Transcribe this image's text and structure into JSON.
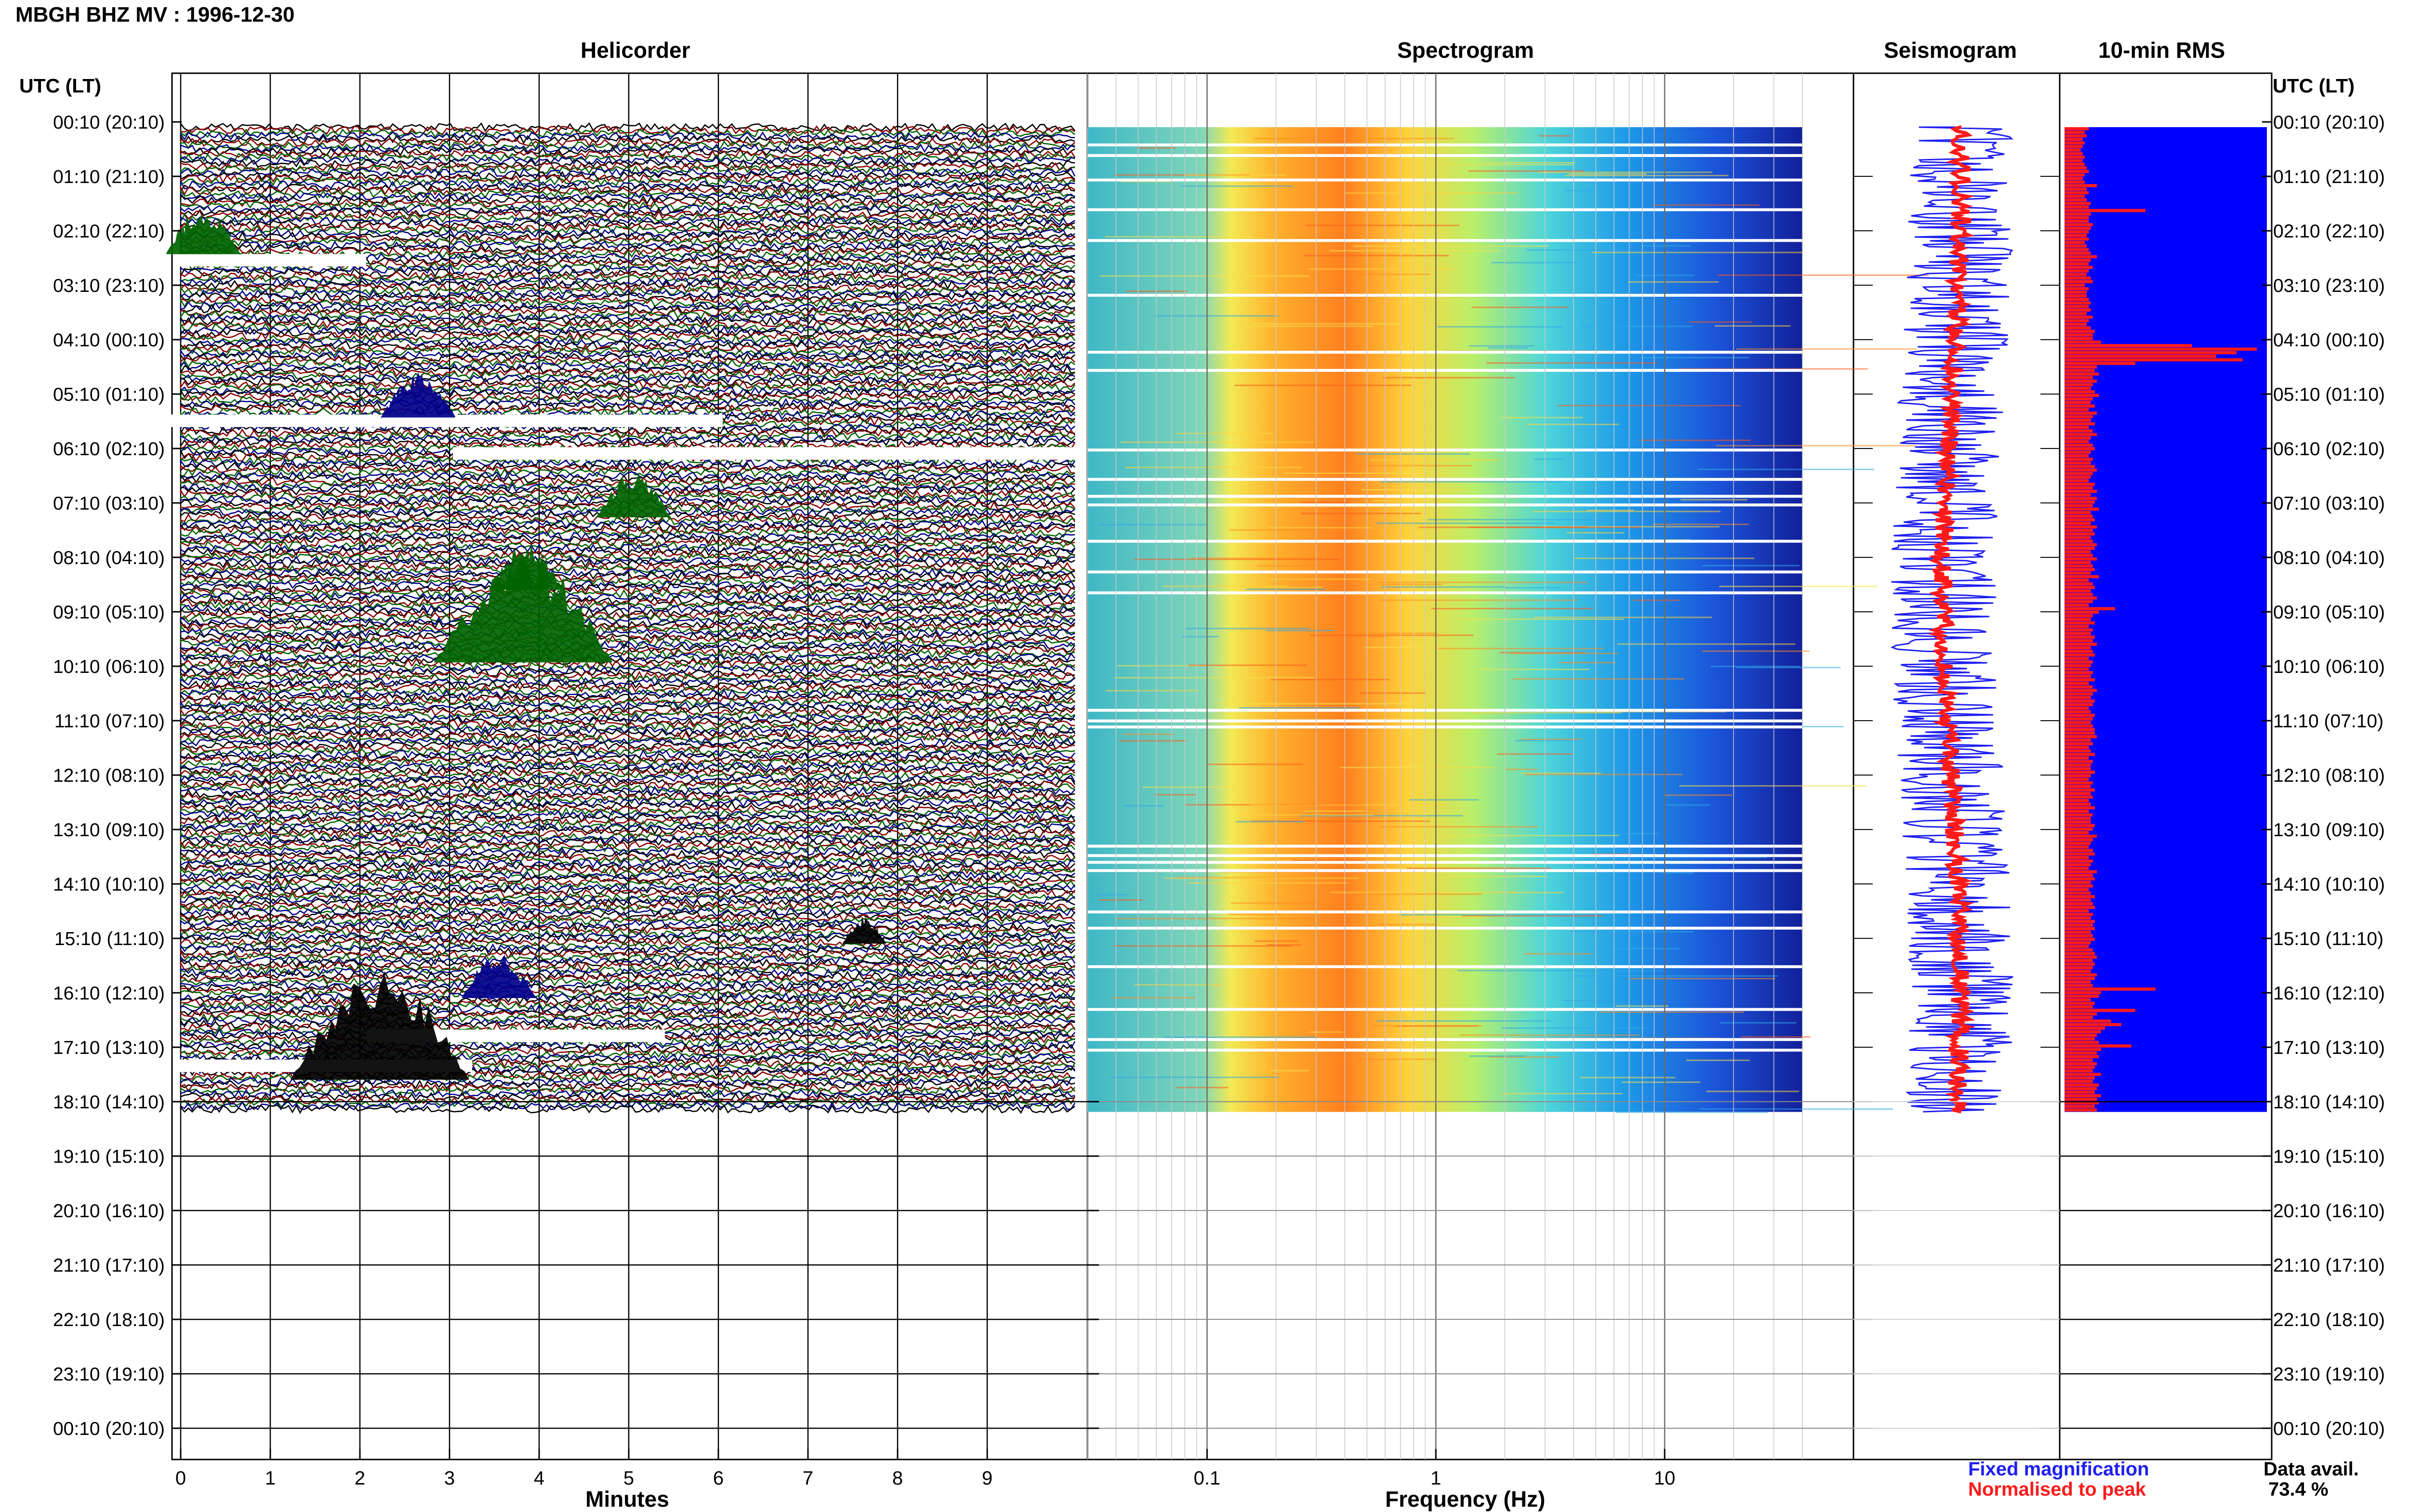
{
  "header": {
    "title": "MBGH BHZ MV : 1996-12-30"
  },
  "panels": {
    "helicorder": "Helicorder",
    "spectrogram": "Spectrogram",
    "seismogram": "Seismogram",
    "rms": "10-min RMS"
  },
  "axes": {
    "time_heading": "UTC (LT)",
    "minutes_label": "Minutes",
    "frequency_label": "Frequency (Hz)"
  },
  "legend": {
    "fixed": "Fixed magnification",
    "normalised": "Normalised to peak",
    "fixed_color": "#1f1ff0",
    "normalised_color": "#ff1a1a"
  },
  "data_availability": {
    "label": "Data avail.",
    "value": "73.4 %"
  },
  "colors": {
    "trace_palette": [
      "#000000",
      "#8b0000",
      "#006400",
      "#00008b"
    ],
    "rms_bar": "#ff1a1a",
    "rms_background": "#0000ff"
  },
  "chart_data": [
    {
      "type": "line",
      "title": "Helicorder",
      "xlabel": "Minutes",
      "xlim": [
        0,
        10
      ],
      "x_ticks": [
        "0",
        "1",
        "2",
        "3",
        "4",
        "5",
        "6",
        "7",
        "8",
        "9"
      ],
      "row_interval_minutes": 10,
      "data_hours_utc": [
        0.167,
        18.1
      ],
      "time_ticks": [
        "00:10 (20:10)",
        "01:10 (21:10)",
        "02:10 (22:10)",
        "03:10 (23:10)",
        "04:10 (00:10)",
        "05:10 (01:10)",
        "06:10 (02:10)",
        "07:10 (03:10)",
        "08:10 (04:10)",
        "09:10 (05:10)",
        "10:10 (06:10)",
        "11:10 (07:10)",
        "12:10 (08:10)",
        "13:10 (09:10)",
        "14:10 (10:10)",
        "15:10 (11:10)",
        "16:10 (12:10)",
        "17:10 (13:10)",
        "18:10 (14:10)",
        "19:10 (15:10)",
        "20:10 (16:10)",
        "21:10 (17:10)",
        "22:10 (18:10)",
        "23:10 (19:10)",
        "00:10 (20:10)"
      ],
      "events": [
        {
          "time_utc": "09:50",
          "minute": 3.7,
          "amplitude": "large"
        },
        {
          "time_utc": "17:30",
          "minute": 2.1,
          "amplitude": "large"
        },
        {
          "time_utc": "05:20",
          "minute": 2.6,
          "amplitude": "medium"
        },
        {
          "time_utc": "07:10",
          "minute": 5.0,
          "amplitude": "medium"
        },
        {
          "time_utc": "08:30",
          "minute": 3.8,
          "amplitude": "medium"
        },
        {
          "time_utc": "16:00",
          "minute": 3.5,
          "amplitude": "medium"
        },
        {
          "time_utc": "02:20",
          "minute": 0.2,
          "amplitude": "medium"
        },
        {
          "time_utc": "15:00",
          "minute": 7.6,
          "amplitude": "small"
        }
      ]
    },
    {
      "type": "heatmap",
      "title": "Spectrogram",
      "xlabel": "Frequency (Hz)",
      "x_scale": "log",
      "x_ticks": [
        "0.1",
        "1",
        "10"
      ],
      "xlim": [
        0.03,
        50
      ],
      "data_hours_utc": [
        0.167,
        18.1
      ],
      "peak_band_hz": [
        0.12,
        0.8
      ],
      "colormap": "jet"
    },
    {
      "type": "line",
      "title": "Seismogram",
      "series": [
        {
          "name": "Fixed magnification",
          "color": "#1f1ff0"
        },
        {
          "name": "Normalised to peak",
          "color": "#ff1a1a"
        }
      ]
    },
    {
      "type": "bar",
      "title": "10-min RMS",
      "orientation": "horizontal",
      "interval_minutes": 10,
      "color": "#ff1a1a",
      "values": [
        0.12,
        0.1,
        0.11,
        0.09,
        0.1,
        0.09,
        0.08,
        0.09,
        0.1,
        0.09,
        0.1,
        0.11,
        0.12,
        0.1,
        0.09,
        0.1,
        0.16,
        0.11,
        0.12,
        0.1,
        0.11,
        0.13,
        0.12,
        0.4,
        0.13,
        0.12,
        0.12,
        0.14,
        0.13,
        0.12,
        0.11,
        0.12,
        0.1,
        0.11,
        0.12,
        0.13,
        0.16,
        0.13,
        0.12,
        0.14,
        0.12,
        0.11,
        0.13,
        0.14,
        0.1,
        0.12,
        0.11,
        0.11,
        0.12,
        0.13,
        0.12,
        0.13,
        0.11,
        0.14,
        0.12,
        0.11,
        0.13,
        0.15,
        0.14,
        0.14,
        0.18,
        0.63,
        0.95,
        0.85,
        0.75,
        0.88,
        0.35,
        0.16,
        0.15,
        0.17,
        0.14,
        0.16,
        0.14,
        0.13,
        0.15,
        0.17,
        0.14,
        0.13,
        0.15,
        0.12,
        0.16,
        0.14,
        0.13,
        0.15,
        0.12,
        0.14,
        0.16,
        0.13,
        0.12,
        0.14,
        0.15,
        0.13,
        0.12,
        0.14,
        0.13,
        0.15,
        0.16,
        0.14,
        0.13,
        0.12,
        0.15,
        0.14,
        0.16,
        0.13,
        0.16,
        0.15,
        0.14,
        0.17,
        0.13,
        0.14,
        0.15,
        0.13,
        0.16,
        0.14,
        0.15,
        0.13,
        0.14,
        0.16,
        0.15,
        0.13,
        0.14,
        0.16,
        0.13,
        0.14,
        0.15,
        0.13,
        0.17,
        0.12,
        0.14,
        0.15,
        0.13,
        0.14,
        0.16,
        0.14,
        0.12,
        0.25,
        0.17,
        0.14,
        0.13,
        0.15,
        0.12,
        0.14,
        0.13,
        0.15,
        0.14,
        0.16,
        0.13,
        0.14,
        0.15,
        0.12,
        0.14,
        0.13,
        0.12,
        0.14,
        0.13,
        0.15,
        0.12,
        0.14,
        0.16,
        0.14,
        0.13,
        0.15,
        0.14,
        0.12,
        0.13,
        0.15,
        0.14,
        0.13,
        0.14,
        0.15,
        0.15,
        0.16,
        0.13,
        0.14,
        0.12,
        0.13,
        0.15,
        0.12,
        0.14,
        0.13,
        0.13,
        0.15,
        0.13,
        0.12,
        0.14,
        0.13,
        0.15,
        0.13,
        0.14,
        0.12,
        0.13,
        0.15,
        0.12,
        0.14,
        0.13,
        0.13,
        0.15,
        0.14,
        0.12,
        0.16,
        0.14,
        0.13,
        0.12,
        0.14,
        0.15,
        0.12,
        0.14,
        0.13,
        0.12,
        0.16,
        0.14,
        0.15,
        0.13,
        0.14,
        0.12,
        0.13,
        0.15,
        0.13,
        0.14,
        0.15,
        0.12,
        0.14,
        0.13,
        0.15,
        0.14,
        0.15,
        0.13,
        0.14,
        0.15,
        0.13,
        0.12,
        0.14,
        0.15,
        0.16,
        0.14,
        0.15,
        0.14,
        0.13,
        0.16,
        0.15,
        0.13,
        0.14,
        0.45,
        0.18,
        0.17,
        0.13,
        0.15,
        0.14,
        0.35,
        0.16,
        0.14,
        0.23,
        0.28,
        0.2,
        0.18,
        0.16,
        0.15,
        0.17,
        0.33,
        0.18,
        0.16,
        0.17,
        0.14,
        0.16,
        0.15,
        0.14,
        0.18,
        0.15,
        0.14,
        0.17,
        0.16,
        0.15,
        0.18,
        0.16,
        0.17,
        0.15,
        0.16
      ]
    }
  ]
}
